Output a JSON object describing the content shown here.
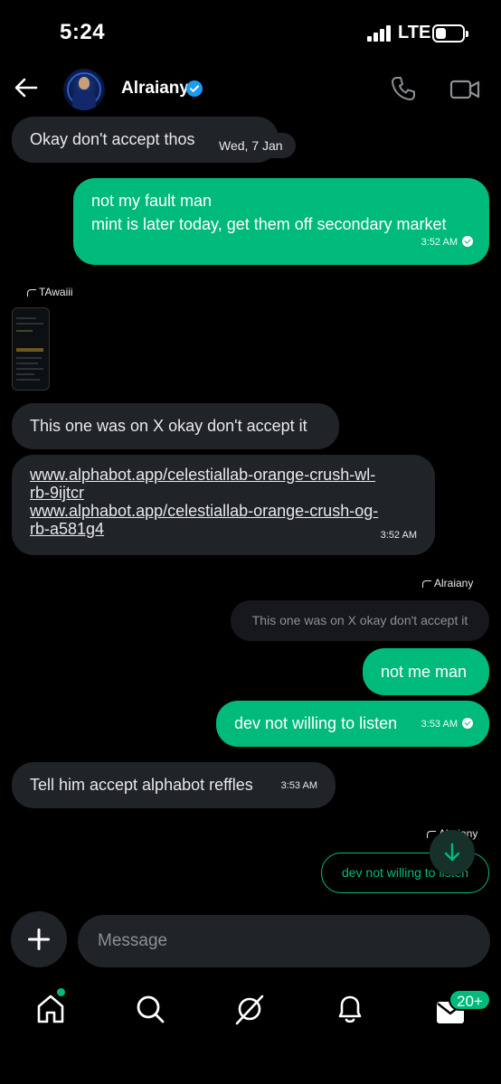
{
  "status": {
    "time": "5:24",
    "network": "LTE"
  },
  "header": {
    "contact_name": "Alraiany"
  },
  "date_separator": "Wed, 7 Jan",
  "messages": {
    "m1": {
      "text": "Okay don't accept thos"
    },
    "m2": {
      "line1": "not my fault man",
      "line2": "mint is later today, get them off secondary market",
      "time": "3:52 AM"
    },
    "reply1": {
      "label": "TAwaiii"
    },
    "m3": {
      "text": "This one was on X okay don't accept it"
    },
    "m4": {
      "link1_a": "www.alphabot.app/celestiallab-orange-crush-wl-",
      "link1_b": "rb-9ijtcr",
      "link2_a": "www.alphabot.app/celestiallab-orange-crush-og-",
      "link2_b": "rb-a581g4",
      "time": "3:52 AM"
    },
    "reply2": {
      "label": "Alraiany",
      "quoted": "This one was on X okay don't accept it"
    },
    "m5": {
      "text": "not me man"
    },
    "m6": {
      "text": "dev not willing to listen",
      "time": "3:53 AM"
    },
    "m7": {
      "text": "Tell him accept alphabot reffles",
      "time": "3:53 AM"
    },
    "reply3": {
      "label": "Alraiany",
      "quoted": "dev not willing to listen"
    }
  },
  "composer": {
    "placeholder": "Message"
  },
  "tabbar": {
    "messages_badge": "20+"
  },
  "colors": {
    "accent": "#00ba7c",
    "incoming_bubble": "#202327",
    "background": "#000000",
    "verified": "#1d9bf0"
  },
  "icons": [
    "back-arrow-icon",
    "verified-badge-icon",
    "phone-icon",
    "video-camera-icon",
    "reply-arrow-icon",
    "read-check-icon",
    "chevron-down-icon",
    "plus-icon",
    "home-icon",
    "search-icon",
    "grok-icon",
    "bell-icon",
    "envelope-icon"
  ]
}
